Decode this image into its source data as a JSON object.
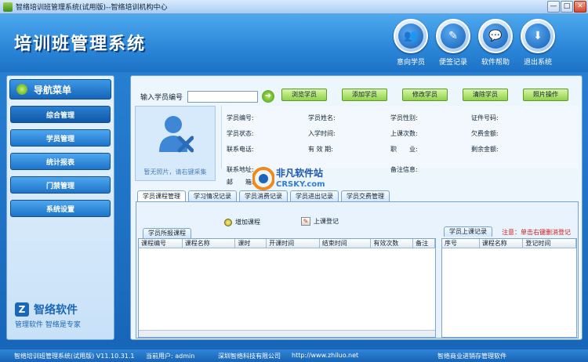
{
  "window": {
    "title": "智络培训班管理系统(试用版)--智络培训机构中心",
    "controls": [
      "—",
      "□",
      "✕"
    ]
  },
  "header": {
    "app_title": "培训班管理系统",
    "toolbar": [
      {
        "label": "意向学员",
        "icon": "people-icon"
      },
      {
        "label": "便签记录",
        "icon": "pen-icon"
      },
      {
        "label": "软件帮助",
        "icon": "speech-bubble-icon"
      },
      {
        "label": "退出系统",
        "icon": "download-arrow-icon"
      }
    ]
  },
  "sidebar": {
    "title": "导航菜单",
    "items": [
      {
        "label": "综合管理",
        "active": true
      },
      {
        "label": "学员管理",
        "active": false
      },
      {
        "label": "统计报表",
        "active": false
      },
      {
        "label": "门禁管理",
        "active": false
      },
      {
        "label": "系统设置",
        "active": false
      }
    ],
    "logo": {
      "name": "智络软件",
      "slogan": "管理软件 智络是专家"
    }
  },
  "search": {
    "label": "输入学员编号",
    "value": "",
    "go_symbol": "➜"
  },
  "actions": [
    "浏览学员",
    "添加学员",
    "修改学员",
    "清除学员",
    "照片操作"
  ],
  "photo": {
    "caption": "暂无照片，请右键采集"
  },
  "student_info": {
    "fields": [
      {
        "label": "学员编号:"
      },
      {
        "label": "学员姓名:"
      },
      {
        "label": "学员性别:"
      },
      {
        "label": "证件号码:"
      },
      {
        "label": "学员状态:"
      },
      {
        "label": "入学时间:"
      },
      {
        "label": "上课次数:"
      },
      {
        "label": "欠费金额:"
      },
      {
        "label": "联系电话:"
      },
      {
        "label": "有 效 期:"
      },
      {
        "label": "职　　业:"
      },
      {
        "label": "剩余金额:"
      },
      {
        "label": "联系地址:"
      },
      {
        "label": "备注信息:"
      },
      {
        "label": "邮　　箱:"
      }
    ]
  },
  "tabs": [
    "学员课程管理",
    "学习情况记录",
    "学员消费记录",
    "学员进出记录",
    "学员交费管理"
  ],
  "course_panel": {
    "add_label": "增加课程",
    "register_label": "上课登记",
    "enrolled_tab": "学员所报课程",
    "enrolled_columns": [
      "课程编号",
      "课程名称",
      "课时",
      "开课时间",
      "结束时间",
      "有效次数",
      "备注"
    ],
    "attendance_tab": "学员上课记录",
    "attendance_note": "注意：单击右键删消登记",
    "attendance_columns": [
      "序号",
      "课程名称",
      "登记时间"
    ]
  },
  "watermark": {
    "cn": "非凡软件站",
    "en": "CRSKY.com"
  },
  "statusbar": {
    "version": "智络培训班管理系统(试用版) V11.10.31.1",
    "user": "当前用户: admin",
    "company": "深圳智络科技有限公司",
    "url": "http://www.zhiluo.net",
    "promo": "智络商业进销存管理软件"
  }
}
